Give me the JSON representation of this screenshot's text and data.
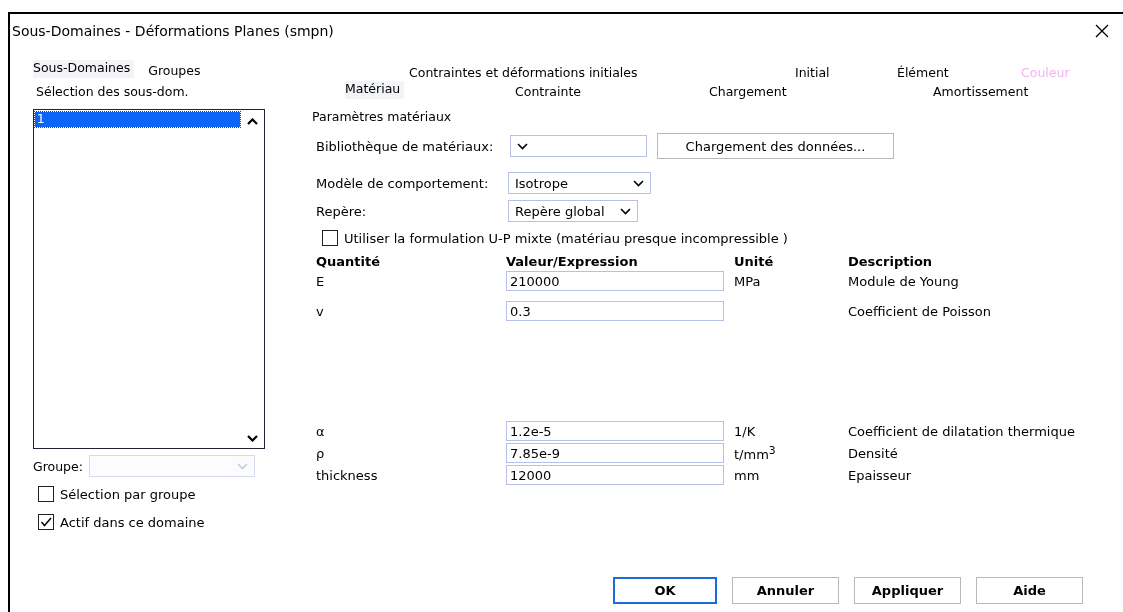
{
  "window": {
    "title": "Sous-Domaines - Déformations Planes (smpn)"
  },
  "left_tabs": [
    {
      "label": "Sous-Domaines",
      "selected": true
    },
    {
      "label": "Groupes",
      "selected": false
    }
  ],
  "selection": {
    "label": "Sélection des sous-dom.",
    "items": [
      {
        "label": "1",
        "selected": true
      }
    ]
  },
  "group": {
    "label": "Groupe:",
    "disabled": true
  },
  "left_checks": [
    {
      "label": "Sélection par groupe",
      "checked": false
    },
    {
      "label": "Actif dans ce domaine",
      "checked": true
    }
  ],
  "tabs_row1": [
    {
      "label": "Contraintes et déformations initiales",
      "selected": false,
      "disabled": false
    },
    {
      "label": "Initial",
      "selected": false,
      "disabled": false
    },
    {
      "label": "Élément",
      "selected": false,
      "disabled": false
    },
    {
      "label": "Couleur",
      "selected": false,
      "disabled": true
    }
  ],
  "tabs_row2": [
    {
      "label": "Matériau",
      "selected": true,
      "disabled": false
    },
    {
      "label": "Contrainte",
      "selected": false,
      "disabled": false
    },
    {
      "label": "Chargement",
      "selected": false,
      "disabled": false
    },
    {
      "label": "Amortissement",
      "selected": false,
      "disabled": false
    }
  ],
  "section_title": "Paramètres matériaux",
  "library": {
    "label": "Bibliothèque de matériaux:",
    "button": "Chargement des données..."
  },
  "model": {
    "label": "Modèle de comportement:",
    "value": "Isotrope"
  },
  "frame": {
    "label": "Repère:",
    "value": "Repère global"
  },
  "mixed": {
    "label": "Utiliser la formulation U-P mixte (matériau presque incompressible )",
    "checked": false
  },
  "table": {
    "columns": [
      "Quantité",
      "Valeur/Expression",
      "Unité",
      "Description"
    ],
    "rows": [
      {
        "quantity": "E",
        "value": "210000",
        "unit": "MPa",
        "description": "Module de Young"
      },
      {
        "quantity": "v",
        "value": "0.3",
        "description": "Coefficient de Poisson"
      },
      {
        "quantity": "α",
        "value": "1.2e-5",
        "unit": "1/K",
        "description": "Coefficient de dilatation thermique"
      },
      {
        "quantity": "ρ",
        "value": "7.85e-9",
        "unit": "t/mm$^{3}$",
        "description": "Densité"
      },
      {
        "quantity": "thickness",
        "value": "12000",
        "unit": "mm",
        "description": "Epaisseur"
      }
    ]
  },
  "buttons": [
    {
      "label": "OK",
      "default": true
    },
    {
      "label": "Annuler",
      "default": false
    },
    {
      "label": "Appliquer",
      "default": false
    },
    {
      "label": "Aide",
      "default": false
    }
  ]
}
